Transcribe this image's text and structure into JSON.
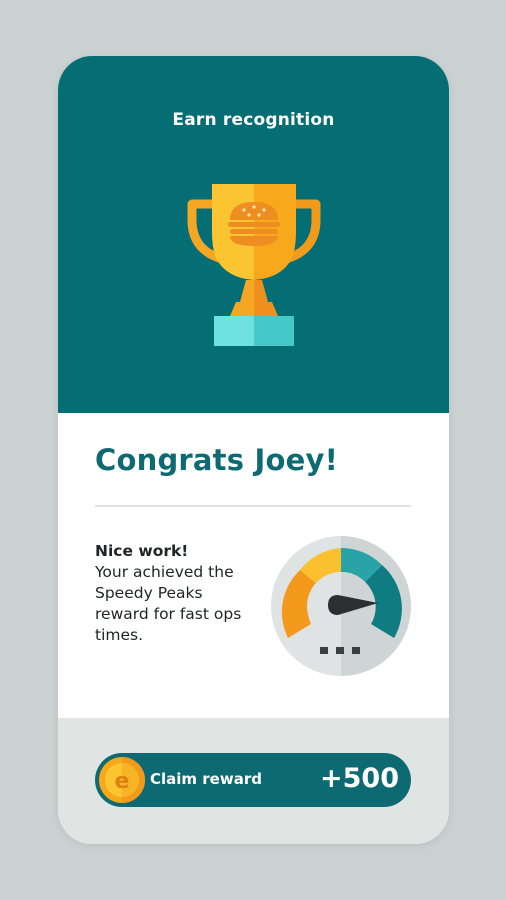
{
  "header": {
    "title": "Earn recognition",
    "trophy_icon": "trophy-burger-icon"
  },
  "main": {
    "heading": "Congrats Joey!",
    "message_lead": "Nice work!",
    "message_body": "Your achieved the Speedy Peaks reward for fast ops times.",
    "gauge_icon": "speedometer-icon"
  },
  "footer": {
    "claim_label": "Claim reward",
    "points": "+500",
    "coin_icon": "coin-icon"
  },
  "colors": {
    "teal_dark": "#056d74",
    "teal_text": "#0d6a73",
    "orange": "#f5a623",
    "yellow": "#fbc531",
    "background": "#c9d1d1",
    "footer_bg": "#e0e5e4"
  }
}
